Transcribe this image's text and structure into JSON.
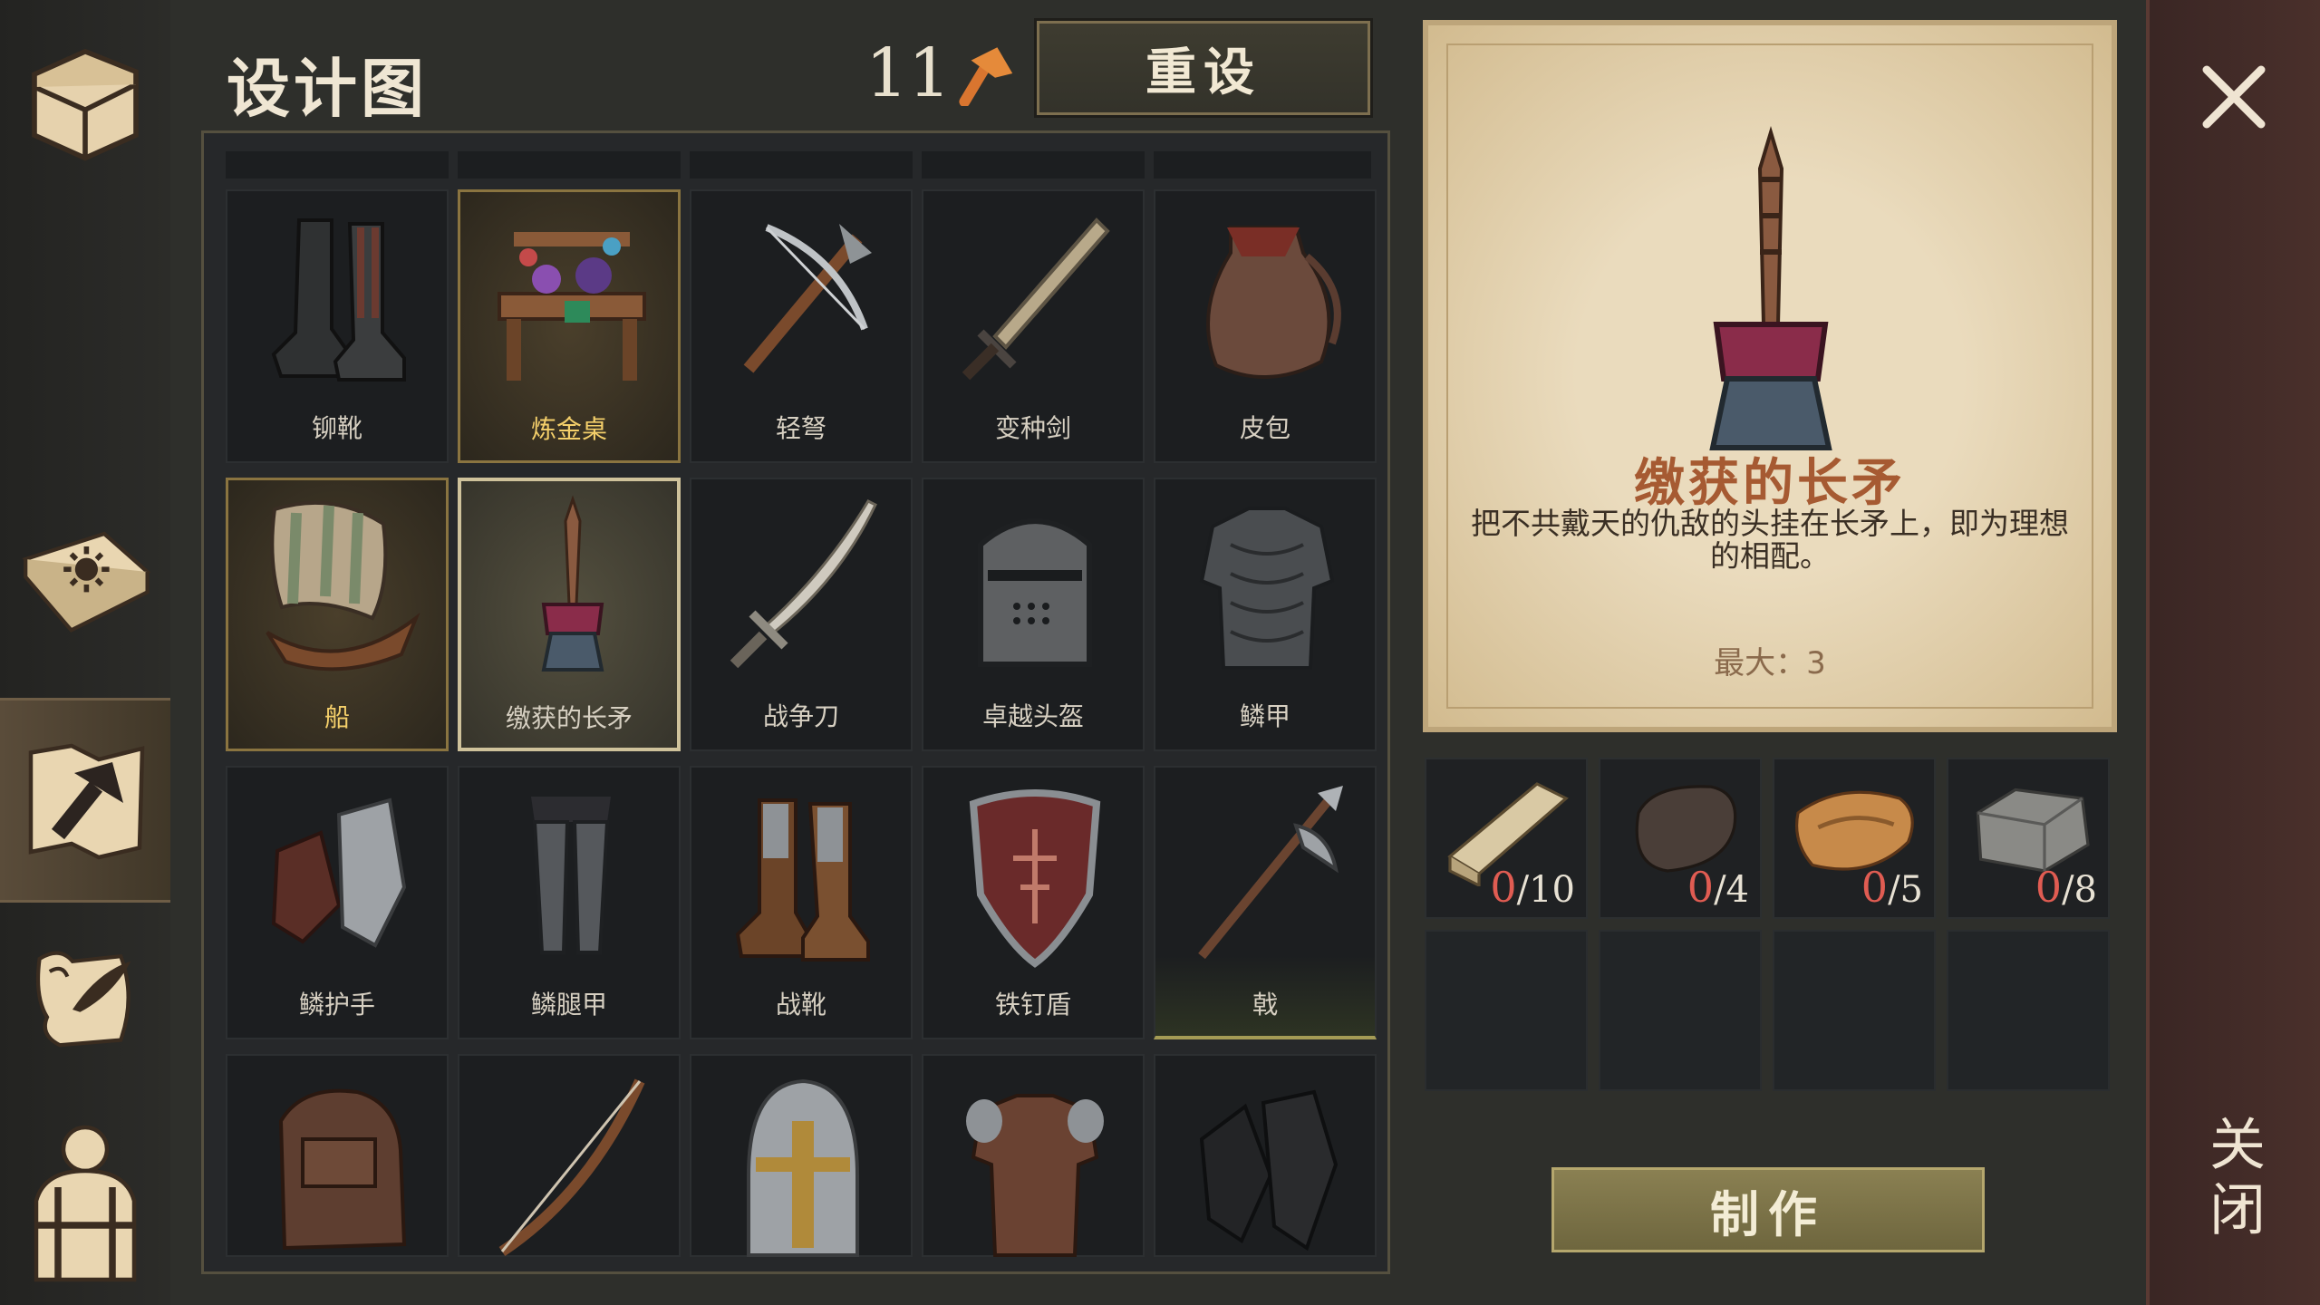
{
  "header": {
    "title": "设计图",
    "blueprint_count": "11",
    "reset_label": "重设"
  },
  "sidebar": {
    "items": [
      {
        "icon": "chest-icon"
      },
      {
        "icon": "sun-book-icon"
      },
      {
        "icon": "blueprint-hammer-icon",
        "active": true
      },
      {
        "icon": "scroll-quill-icon"
      },
      {
        "icon": "character-backpack-icon"
      }
    ]
  },
  "grid": {
    "items": [
      {
        "label": "铆靴",
        "icon": "boots-icon"
      },
      {
        "label": "炼金桌",
        "icon": "alchemy-table-icon",
        "state": "gold"
      },
      {
        "label": "轻弩",
        "icon": "crossbow-icon"
      },
      {
        "label": "变种剑",
        "icon": "sword-icon"
      },
      {
        "label": "皮包",
        "icon": "leather-bag-icon"
      },
      {
        "label": "船",
        "icon": "ship-icon",
        "state": "gold"
      },
      {
        "label": "缴获的长矛",
        "icon": "captured-spear-icon",
        "state": "selected"
      },
      {
        "label": "战争刀",
        "icon": "war-blade-icon"
      },
      {
        "label": "卓越头盔",
        "icon": "great-helm-icon"
      },
      {
        "label": "鳞甲",
        "icon": "scale-armor-icon"
      },
      {
        "label": "鳞护手",
        "icon": "scale-gauntlets-icon"
      },
      {
        "label": "鳞腿甲",
        "icon": "scale-greaves-icon"
      },
      {
        "label": "战靴",
        "icon": "war-boots-icon"
      },
      {
        "label": "铁钉盾",
        "icon": "iron-shield-icon"
      },
      {
        "label": "戟",
        "icon": "halberd-icon",
        "state": "green"
      },
      {
        "label": "",
        "icon": "backpack-icon"
      },
      {
        "label": "",
        "icon": "bow-icon"
      },
      {
        "label": "",
        "icon": "nasal-helmet-icon"
      },
      {
        "label": "",
        "icon": "leather-armor-icon"
      },
      {
        "label": "",
        "icon": "gloves-icon"
      }
    ]
  },
  "detail": {
    "name": "缴获的长矛",
    "description": "把不共戴天的仇敌的头挂在长矛上，即为理想的相配。",
    "max_label": "最大：3",
    "materials": [
      {
        "icon": "wood-planks-icon",
        "have": "0",
        "need": "/10"
      },
      {
        "icon": "iron-ingot-icon",
        "have": "0",
        "need": "/4"
      },
      {
        "icon": "leather-roll-icon",
        "have": "0",
        "need": "/5"
      },
      {
        "icon": "stone-block-icon",
        "have": "0",
        "need": "/8"
      }
    ],
    "craft_label": "制作"
  },
  "close": {
    "label": "关闭"
  },
  "colors": {
    "accent_gold": "#cfc29b",
    "name_red": "#a65a32",
    "missing_red": "#e05c52"
  }
}
